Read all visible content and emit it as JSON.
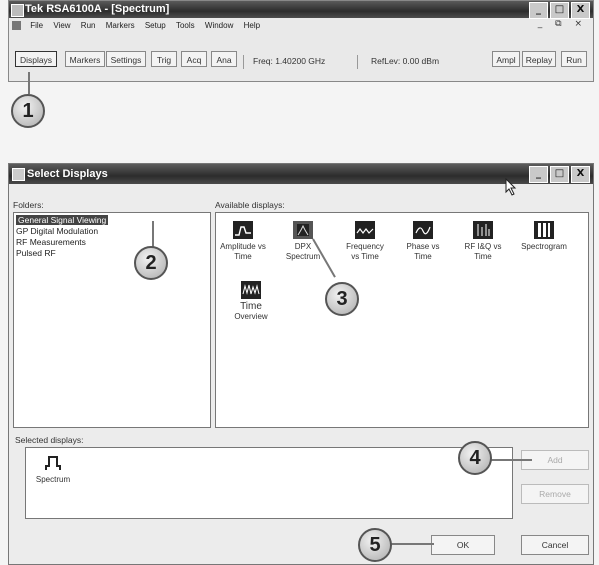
{
  "main_window": {
    "title": "Tek RSA6100A - [Spectrum]",
    "controls": [
      "_",
      "□",
      "X"
    ],
    "menu": [
      "File",
      "View",
      "Run",
      "Markers",
      "Setup",
      "Tools",
      "Window",
      "Help"
    ],
    "mdi_controls": "_ ⧉ ×",
    "toolbar": {
      "displays": "Displays",
      "markers": "Markers",
      "settings": "Settings",
      "trig": "Trig",
      "acq": "Acq",
      "ana": "Ana",
      "freq": "Freq: 1.40200 GHz",
      "reflev": "RefLev: 0.00 dBm",
      "ampl": "Ampl",
      "replay": "Replay",
      "run": "Run"
    }
  },
  "callouts": [
    "1",
    "2",
    "3",
    "4",
    "5"
  ],
  "dialog": {
    "title": "Select Displays",
    "controls": [
      "_",
      "□",
      "X"
    ],
    "folders_label": "Folders:",
    "folders": [
      "General Signal Viewing",
      "GP Digital Modulation",
      "RF Measurements",
      "Pulsed RF"
    ],
    "available_label": "Available displays:",
    "available": [
      {
        "line1": "Amplitude vs",
        "line2": "Time",
        "icon": "amplitude-vs-time-icon"
      },
      {
        "line1": "DPX",
        "line2": "Spectrum",
        "icon": "dpx-spectrum-icon"
      },
      {
        "line1": "Frequency",
        "line2": "vs Time",
        "icon": "frequency-vs-time-icon"
      },
      {
        "line1": "Phase vs",
        "line2": "Time",
        "icon": "phase-vs-time-icon"
      },
      {
        "line1": "RF I&Q vs",
        "line2": "Time",
        "icon": "rf-iq-vs-time-icon"
      },
      {
        "line1": "Spectrogram",
        "line2": "",
        "icon": "spectrogram-icon"
      },
      {
        "line1": "Time",
        "line2": "Overview",
        "icon": "time-overview-icon"
      }
    ],
    "selected_label": "Selected displays:",
    "selected": [
      {
        "label": "Spectrum",
        "icon": "spectrum-icon"
      }
    ],
    "buttons": {
      "add": "Add",
      "remove": "Remove",
      "ok": "OK",
      "cancel": "Cancel"
    }
  }
}
